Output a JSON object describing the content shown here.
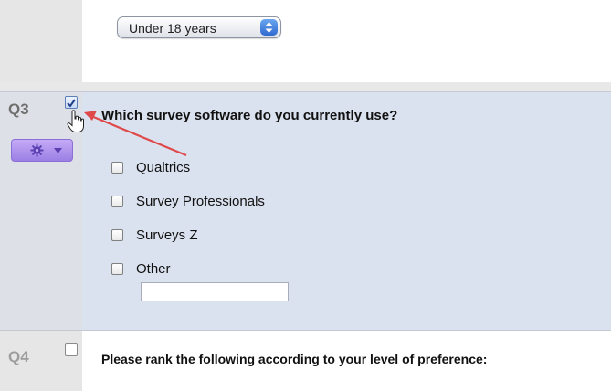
{
  "age_select": {
    "value": "Under 18 years"
  },
  "q3": {
    "number": "Q3",
    "text": "Which survey software do you currently use?",
    "choices": [
      {
        "label": "Qualtrics"
      },
      {
        "label": "Survey Professionals"
      },
      {
        "label": "Surveys Z"
      },
      {
        "label": "Other"
      }
    ],
    "other_text_value": ""
  },
  "q4": {
    "number": "Q4",
    "text": "Please rank the following according to your level of preference:"
  },
  "colors": {
    "question_highlight": "#dbe2ef",
    "gutter": "#e6e6e6",
    "gear_button": "#b395f0",
    "annotation_arrow": "#e0494a"
  },
  "icons": [
    "stepper-icon",
    "gear-icon",
    "chevron-down-icon",
    "hand-cursor-icon",
    "arrow-annotation"
  ]
}
